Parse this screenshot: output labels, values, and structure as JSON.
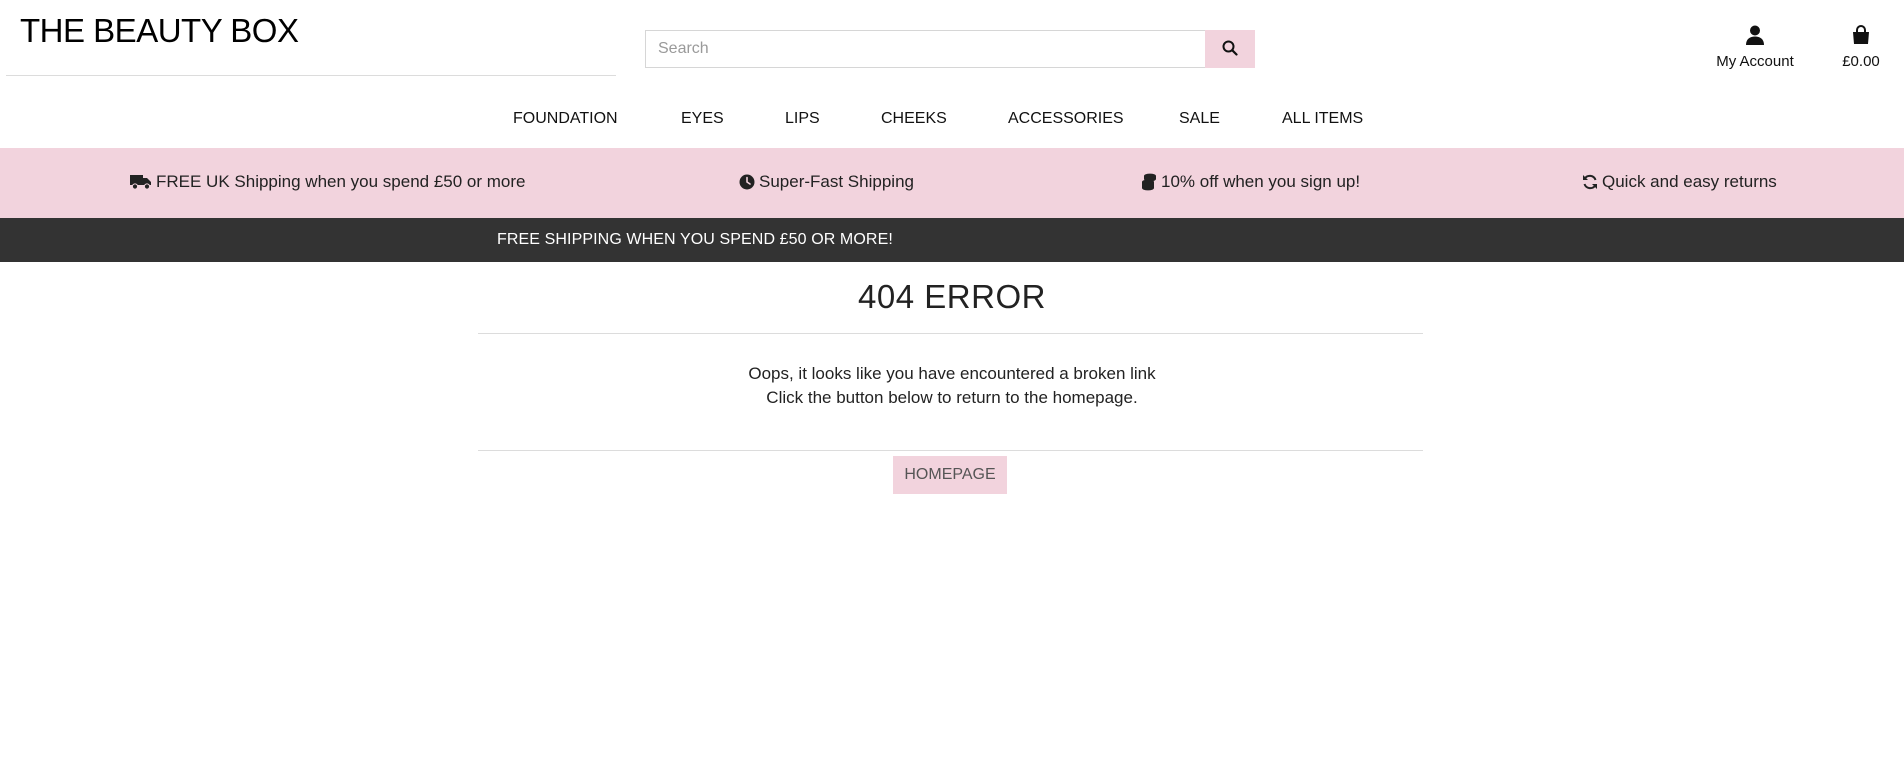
{
  "brand": {
    "logo_text": "THE BEAUTY BOX"
  },
  "search": {
    "placeholder": "Search",
    "value": "",
    "icon": "search-icon"
  },
  "account": {
    "label": "My Account",
    "icon": "user-icon"
  },
  "bag": {
    "total": "£0.00",
    "icon": "shopping-bag-icon"
  },
  "nav": {
    "items": [
      "FOUNDATION",
      "EYES",
      "LIPS",
      "CHEEKS",
      "ACCESSORIES",
      "SALE",
      "ALL ITEMS"
    ]
  },
  "features": [
    {
      "icon": "truck-icon",
      "text": "FREE UK Shipping when you spend £50 or more"
    },
    {
      "icon": "clock-icon",
      "text": "Super-Fast Shipping"
    },
    {
      "icon": "coins-icon",
      "text": "10% off when you sign up!"
    },
    {
      "icon": "sync-icon",
      "text": "Quick and easy returns"
    }
  ],
  "banner": {
    "text": "FREE SHIPPING WHEN YOU SPEND £50 OR MORE!"
  },
  "error": {
    "title": "404 ERROR",
    "message_line1": "Oops, it looks like you have encountered a broken link",
    "message_line2": "Click the button below to return to the homepage.",
    "button_label": "HOMEPAGE"
  },
  "colors": {
    "accent_pink": "#f2d3dd",
    "banner_dark": "#333333",
    "text": "#222222"
  }
}
